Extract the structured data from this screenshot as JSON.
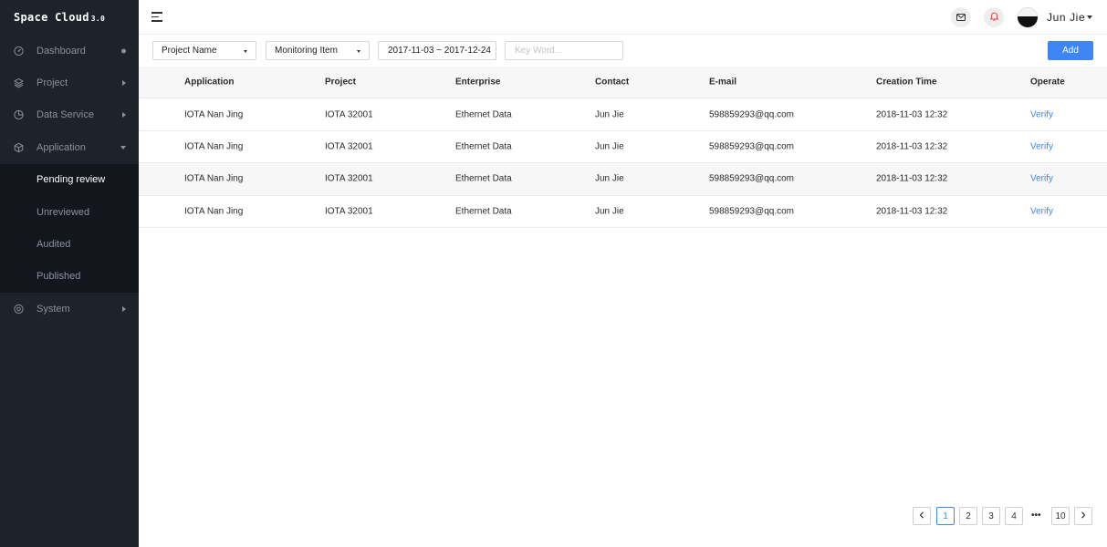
{
  "app": {
    "logo": "Space Cloud",
    "version": "3.0"
  },
  "sidebar": {
    "items": [
      {
        "label": "Dashboard",
        "icon": "dashboard-icon"
      },
      {
        "label": "Project",
        "icon": "layers-icon"
      },
      {
        "label": "Data Service",
        "icon": "pie-chart-icon"
      },
      {
        "label": "Application",
        "icon": "cube-icon",
        "expanded": true
      }
    ],
    "submenu": [
      {
        "label": "Pending review",
        "active": true
      },
      {
        "label": "Unreviewed"
      },
      {
        "label": "Audited"
      },
      {
        "label": "Published"
      }
    ],
    "system": {
      "label": "System",
      "icon": "gear-icon"
    }
  },
  "header": {
    "user_name": "Jun Jie",
    "icons": [
      "mail-icon",
      "bell-icon"
    ]
  },
  "filters": {
    "project_select": "Project Name",
    "monitoring_select": "Monitoring Item",
    "date_range": "2017-11-03 ~ 2017-12-24",
    "keyword_placeholder": "Key Word...",
    "add_label": "Add"
  },
  "table": {
    "columns": [
      "Application",
      "Project",
      "Enterprise",
      "Contact",
      "E-mail",
      "Creation Time",
      "Operate"
    ],
    "rows": [
      [
        "IOTA Nan Jing",
        "IOTA 32001",
        "Ethernet Data",
        "Jun Jie",
        "598859293@qq.com",
        "2018-11-03 12:32",
        "Verify"
      ],
      [
        "IOTA Nan Jing",
        "IOTA 32001",
        "Ethernet Data",
        "Jun Jie",
        "598859293@qq.com",
        "2018-11-03 12:32",
        "Verify"
      ],
      [
        "IOTA Nan Jing",
        "IOTA 32001",
        "Ethernet Data",
        "Jun Jie",
        "598859293@qq.com",
        "2018-11-03 12:32",
        "Verify"
      ],
      [
        "IOTA Nan Jing",
        "IOTA 32001",
        "Ethernet Data",
        "Jun Jie",
        "598859293@qq.com",
        "2018-11-03 12:32",
        "Verify"
      ]
    ]
  },
  "pagination": {
    "pages": [
      "1",
      "2",
      "3",
      "4"
    ],
    "ellipsis": "•••",
    "last": "10",
    "current": "1"
  },
  "colors": {
    "accent": "#3d86f4",
    "sidebar_bg": "#1e222b",
    "submenu_bg": "#13161c"
  }
}
